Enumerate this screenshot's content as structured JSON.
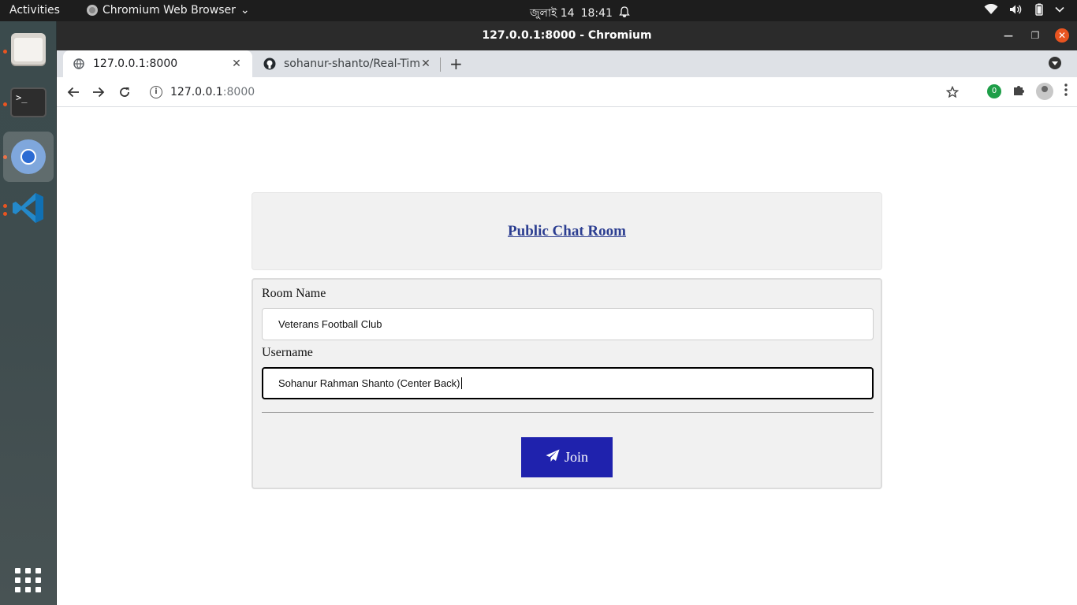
{
  "topbar": {
    "activities": "Activities",
    "app_name": "Chromium Web Browser",
    "date": "জুলাই 14",
    "time": "18:41"
  },
  "dock": {
    "items": [
      {
        "name": "files-icon"
      },
      {
        "name": "terminal-icon",
        "glyph": ">_"
      },
      {
        "name": "chromium-icon"
      },
      {
        "name": "vscode-icon"
      },
      {
        "name": "show-apps-icon"
      }
    ]
  },
  "window": {
    "title": "127.0.0.1:8000 - Chromium"
  },
  "tabs": [
    {
      "title": "127.0.0.1:8000",
      "active": true
    },
    {
      "title": "sohanur-shanto/Real-Tim",
      "active": false
    }
  ],
  "address": {
    "host": "127.0.0.1",
    "port": ":8000"
  },
  "extension_badge": "0",
  "page": {
    "heading": "Public Chat Room",
    "room_label": "Room Name",
    "room_value": "Veterans Football Club",
    "user_label": "Username",
    "user_value": "Sohanur Rahman Shanto (Center Back)",
    "join_label": "Join"
  },
  "colors": {
    "join_button": "#1f22ad",
    "heading_link": "#2c3e91",
    "accent": "#e95420"
  }
}
